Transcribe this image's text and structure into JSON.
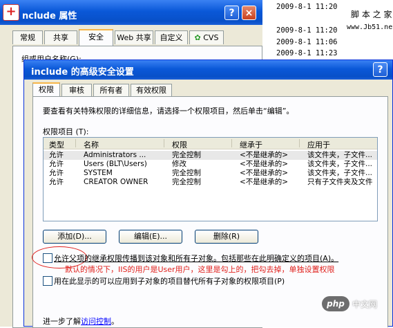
{
  "back_window": {
    "title": "nclude 属性",
    "tabs": [
      "常规",
      "共享",
      "安全",
      "Web 共享",
      "自定义",
      "CVS"
    ],
    "active_tab": "安全",
    "group_label": "组或用户名称(G):",
    "help_button": "?",
    "close_button": "×"
  },
  "file_list": {
    "dates": [
      "2009-8-1 11:20",
      "2009-8-1 11:20",
      "2009-8-1 11:06",
      "2009-8-1 11:23"
    ],
    "watermark_name": "脚 本 之 家",
    "watermark_url": "www.Jb51.net"
  },
  "dialog": {
    "title": "include 的高级安全设置",
    "help_button": "?",
    "close_button": "×",
    "tabs": [
      "权限",
      "审核",
      "所有者",
      "有效权限"
    ],
    "active_tab": "权限",
    "description": "要查看有关特殊权限的详细信息，请选择一个权限项目，然后单击“编辑”。",
    "entries_label": "权限项目 (T):",
    "table": {
      "headers": [
        "类型",
        "名称",
        "权限",
        "继承于",
        "应用于"
      ],
      "rows": [
        [
          "允许",
          "Administrators ...",
          "完全控制",
          "<不是继承的>",
          "该文件夹，子文件..."
        ],
        [
          "允许",
          "Users (BLT\\Users)",
          "修改",
          "<不是继承的>",
          "该文件夹，子文件..."
        ],
        [
          "允许",
          "SYSTEM",
          "完全控制",
          "<不是继承的>",
          "该文件夹，子文件..."
        ],
        [
          "允许",
          "CREATOR OWNER",
          "完全控制",
          "<不是继承的>",
          "只有子文件夹及文件"
        ]
      ]
    },
    "buttons": {
      "add": "添加(D)...",
      "edit": "编辑(E)...",
      "remove": "删除(R)"
    },
    "inherit_checkbox": "允许父项的继承权限传播到该对象和所有子对象。包括那些在此明确定义的项目(A)。",
    "annotation": "默认的情况下，IIS的用户是User用户，这里是勾上的，把勾去掉，单独设置权限",
    "replace_checkbox": "用在此显示的可以应用到子对象的项目替代所有子对象的权限项目(P)",
    "learn_prefix": "进一步了解",
    "learn_link": "访问控制",
    "learn_suffix": "。"
  },
  "watermark": {
    "badge": "php",
    "text": "中文网"
  },
  "colors": {
    "titlebar": "#0a58d8",
    "annotation": "#e0201c",
    "link": "#0000ff"
  }
}
